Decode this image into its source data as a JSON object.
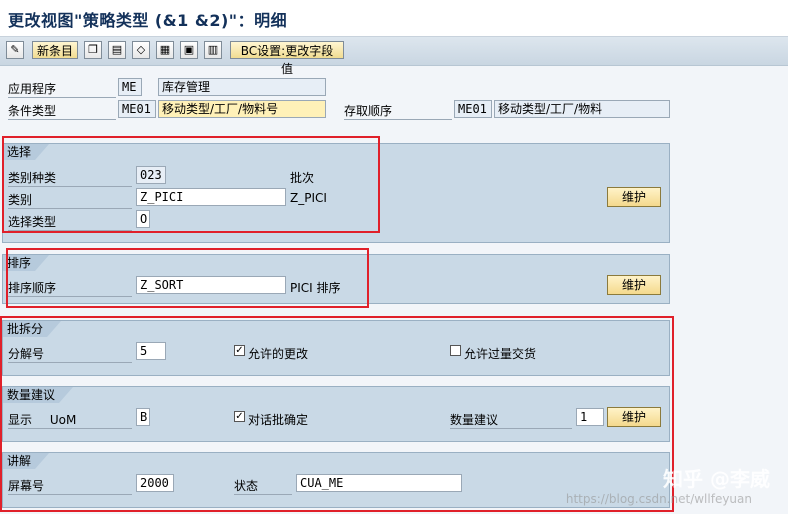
{
  "window": {
    "title": "更改视图\"策略类型 (&1 &2)\"：明细"
  },
  "toolbar": {
    "new_entries": "新条目",
    "bc_settings": "BC设置:更改字段值"
  },
  "header": {
    "app_label": "应用程序",
    "app_code": "ME",
    "app_desc": "库存管理",
    "cond_type_label": "条件类型",
    "cond_type_code": "ME01",
    "cond_type_desc": "移动类型/工厂/物料号",
    "access_seq_label": "存取顺序",
    "access_seq_code": "ME01",
    "access_seq_desc": "移动类型/工厂/物料"
  },
  "selection": {
    "title": "选择",
    "class_kind_label": "类别种类",
    "class_kind_value": "023",
    "class_kind_desc": "批次",
    "class_label": "类别",
    "class_value": "Z_PICI",
    "class_desc": "Z_PICI",
    "sel_type_label": "选择类型",
    "sel_type_value": "O",
    "maintain": "维护"
  },
  "sort": {
    "title": "排序",
    "sort_seq_label": "排序顺序",
    "sort_seq_value": "Z_SORT",
    "sort_seq_desc": "PICI 排序",
    "maintain": "维护"
  },
  "batch_split": {
    "title": "批拆分",
    "split_label": "分解号",
    "split_value": "5",
    "allow_change_label": "允许的更改",
    "allow_change_checked": true,
    "allow_over_label": "允许过量交货",
    "allow_over_checked": false
  },
  "qty_proposal": {
    "title": "数量建议",
    "display_label": "显示",
    "uom_label": "UoM",
    "uom_value": "B",
    "dialog_label": "对话批确定",
    "dialog_checked": true,
    "qty_label": "数量建议",
    "qty_value": "1",
    "maintain": "维护"
  },
  "explain": {
    "title": "讲解",
    "screen_label": "屏幕号",
    "screen_value": "2000",
    "status_label": "状态",
    "status_value": "CUA_ME"
  },
  "watermark": {
    "text": "知乎 @李威",
    "url": "https://blog.csdn.net/wllfeyuan"
  },
  "colors": {
    "highlight_box": "#e0202a",
    "group_bg": "#c9d9e6",
    "button": "#f4d98d"
  }
}
